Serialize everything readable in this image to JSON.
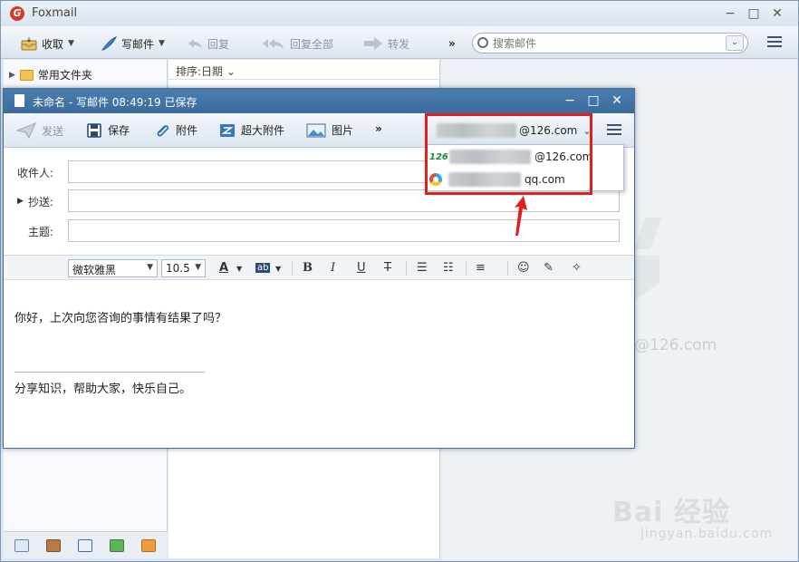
{
  "app": {
    "title": "Foxmail",
    "logo_letter": "G",
    "window_controls": [
      "−",
      "□",
      "✕"
    ]
  },
  "toolbar": {
    "receive": "收取",
    "compose": "写邮件",
    "reply": "回复",
    "reply_all": "回复全部",
    "forward": "转发",
    "more": "»",
    "search_placeholder": "搜索邮件",
    "search_dropdown": "⌄"
  },
  "folders": {
    "common_folder": "常用文件夹"
  },
  "mail_list": {
    "sort_label": "排序:日期 ⌄"
  },
  "preview": {
    "ghost_email": "@126.com"
  },
  "compose": {
    "title": "未命名 - 写邮件    08:49:19 已保存",
    "controls": [
      "−",
      "□",
      "✕"
    ],
    "toolbar": {
      "send": "发送",
      "save": "保存",
      "attach": "附件",
      "big_attach": "超大附件",
      "image": "图片",
      "more": "»"
    },
    "sender": {
      "suffix": "@126.com",
      "caret": "⌄"
    },
    "fields": {
      "to_label": "收件人:",
      "cc_label": "抄送:",
      "cc_arrow": "▶",
      "subject_label": "主题:"
    },
    "format": {
      "font": "微软雅黑",
      "size": "10.5",
      "buttons": [
        "A",
        "ab",
        "B",
        "I",
        "U",
        "T",
        "☰",
        "☷",
        "≡",
        "☺",
        "✎",
        "✧"
      ]
    },
    "body": {
      "text": "你好，上次向您咨询的事情有结果了吗？",
      "signature": "分享知识，帮助大家，快乐自己。"
    }
  },
  "account_dropdown": {
    "items": [
      {
        "badge": "126",
        "suffix": "@126.com"
      },
      {
        "badge": "qq",
        "suffix": "qq.com"
      }
    ]
  },
  "watermark": {
    "logo": "Bai 经验",
    "url": "jingyan.baidu.com"
  },
  "colors": {
    "highlight": "#e02020",
    "title_bar": "#3b6b9c",
    "accent_green": "#1b8a3a"
  }
}
